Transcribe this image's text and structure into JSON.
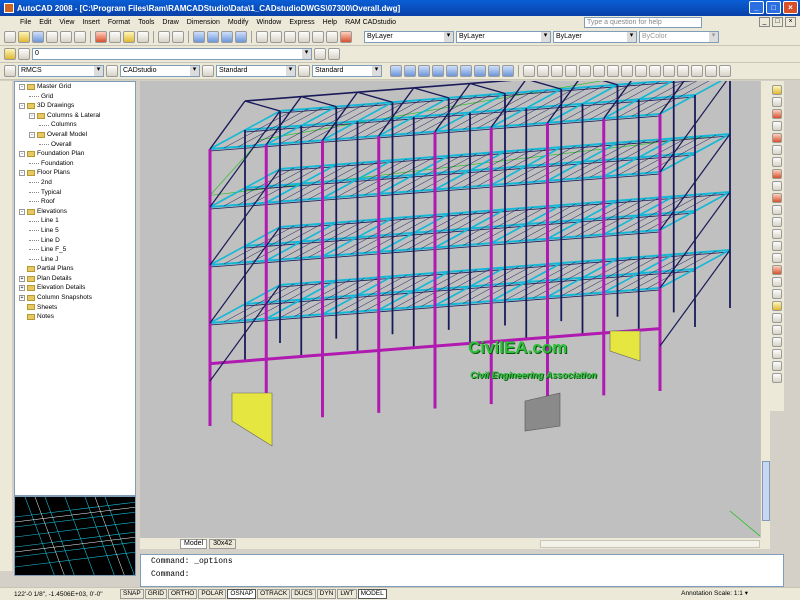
{
  "window": {
    "title": "AutoCAD 2008 - [C:\\Program Files\\Ram\\RAMCADStudio\\Data\\1_CADstudioDWGS\\07300\\Overall.dwg]",
    "help_placeholder": "Type a question for help"
  },
  "menu": [
    "File",
    "Edit",
    "View",
    "Insert",
    "Format",
    "Tools",
    "Draw",
    "Dimension",
    "Modify",
    "Window",
    "Express",
    "Help",
    "RAM CADstudio"
  ],
  "toolbars": {
    "layer_combo": "0",
    "color_combo": "ByLayer",
    "linetype_combo": "ByLayer",
    "lineweight_combo": "ByLayer",
    "plotstyle_combo": "ByColor",
    "ram_combo": "RMCS",
    "cad_combo": "CADstudio",
    "textstyle_combo": "Standard",
    "dimstyle_combo": "Standard"
  },
  "tree": [
    {
      "level": 0,
      "expander": "-",
      "label": "Master Grid",
      "folder": true
    },
    {
      "level": 1,
      "expander": "",
      "label": "Grid",
      "folder": false
    },
    {
      "level": 0,
      "expander": "-",
      "label": "3D Drawings",
      "folder": true
    },
    {
      "level": 1,
      "expander": "-",
      "label": "Columns & Lateral",
      "folder": true
    },
    {
      "level": 2,
      "expander": "",
      "label": "Columns",
      "folder": false
    },
    {
      "level": 1,
      "expander": "-",
      "label": "Overall Model",
      "folder": true
    },
    {
      "level": 2,
      "expander": "",
      "label": "Overall",
      "folder": false
    },
    {
      "level": 0,
      "expander": "-",
      "label": "Foundation Plan",
      "folder": true
    },
    {
      "level": 1,
      "expander": "",
      "label": "Foundation",
      "folder": false
    },
    {
      "level": 0,
      "expander": "-",
      "label": "Floor Plans",
      "folder": true
    },
    {
      "level": 1,
      "expander": "",
      "label": "2nd",
      "folder": false
    },
    {
      "level": 1,
      "expander": "",
      "label": "Typical",
      "folder": false
    },
    {
      "level": 1,
      "expander": "",
      "label": "Roof",
      "folder": false
    },
    {
      "level": 0,
      "expander": "-",
      "label": "Elevations",
      "folder": true
    },
    {
      "level": 1,
      "expander": "",
      "label": "Line 1",
      "folder": false
    },
    {
      "level": 1,
      "expander": "",
      "label": "Line 5",
      "folder": false
    },
    {
      "level": 1,
      "expander": "",
      "label": "Line D",
      "folder": false
    },
    {
      "level": 1,
      "expander": "",
      "label": "Line F_5",
      "folder": false
    },
    {
      "level": 1,
      "expander": "",
      "label": "Line J",
      "folder": false
    },
    {
      "level": 0,
      "expander": "",
      "label": "Partial Plans",
      "folder": true
    },
    {
      "level": 0,
      "expander": "+",
      "label": "Plan Details",
      "folder": true
    },
    {
      "level": 0,
      "expander": "+",
      "label": "Elevation Details",
      "folder": true
    },
    {
      "level": 0,
      "expander": "+",
      "label": "Column Snapshots",
      "folder": true
    },
    {
      "level": 0,
      "expander": "",
      "label": "Sheets",
      "folder": true
    },
    {
      "level": 0,
      "expander": "",
      "label": "Notes",
      "folder": true
    }
  ],
  "tabs": [
    "Model",
    "30x42"
  ],
  "command": {
    "line1": "Command: _options",
    "line2": "Command:"
  },
  "watermark": {
    "brand": "CivilEA.com",
    "tagline": "Civil Engineering Association"
  },
  "status": {
    "coords": "122'-0 1/8\",  -1.4506E+03, 0'-0\"",
    "buttons": [
      "SNAP",
      "GRID",
      "ORTHO",
      "POLAR",
      "OSNAP",
      "OTRACK",
      "DUCS",
      "DYN",
      "LWT",
      "MODEL"
    ],
    "active_buttons": [
      "OSNAP",
      "MODEL"
    ],
    "annotation_scale": "Annotation Scale:  1:1 ▾"
  },
  "colors": {
    "viewport_bg": "#c0c0c0",
    "columns": "#b01ab0",
    "beams": "#14b8d6",
    "frames": "#1a1a5a",
    "walls": "#e6e640",
    "boundary": "#18c018"
  }
}
